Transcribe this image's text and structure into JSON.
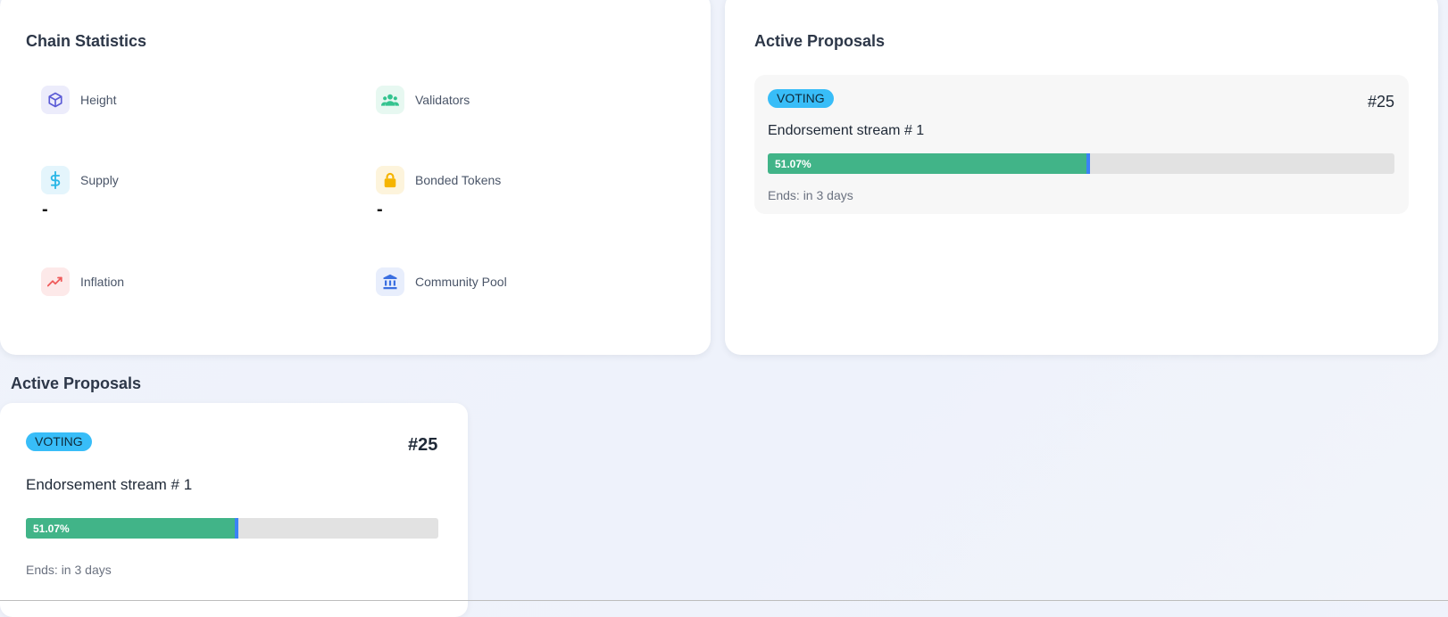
{
  "stats": {
    "title": "Chain Statistics",
    "items": [
      {
        "label": "Height",
        "value": "",
        "icon": "cube-icon",
        "color": "#5b5bd6",
        "bg": "#ececfb"
      },
      {
        "label": "Validators",
        "value": "",
        "icon": "users-icon",
        "color": "#34c38f",
        "bg": "#e7f8f1"
      },
      {
        "label": "Supply",
        "value": "-",
        "icon": "dollar-icon",
        "color": "#29b6e6",
        "bg": "#e4f5fc"
      },
      {
        "label": "Bonded Tokens",
        "value": "-",
        "icon": "lock-icon",
        "color": "#f5b400",
        "bg": "#fdf4dc"
      },
      {
        "label": "Inflation",
        "value": "",
        "icon": "trending-up-icon",
        "color": "#ef5a5a",
        "bg": "#fde9e9"
      },
      {
        "label": "Community Pool",
        "value": "",
        "icon": "bank-icon",
        "color": "#3b6fe0",
        "bg": "#e8eefc"
      }
    ]
  },
  "proposals_card": {
    "title": "Active Proposals",
    "proposal": {
      "status": "VOTING",
      "number": "#25",
      "title": "Endorsement stream # 1",
      "yes_percent_label": "51.07%",
      "yes_fraction": 0.5107,
      "ends": "Ends: in 3 days"
    }
  },
  "section": {
    "title": "Active Proposals",
    "proposal": {
      "status": "VOTING",
      "number": "#25",
      "title": "Endorsement stream # 1",
      "yes_percent_label": "51.07%",
      "yes_fraction": 0.5107,
      "ends": "Ends: in 3 days"
    }
  },
  "colors": {
    "badge": "#38bdf8",
    "yes_bar": "#41b488",
    "bar_bg": "#e2e2e2",
    "marker": "#3b82f6"
  }
}
